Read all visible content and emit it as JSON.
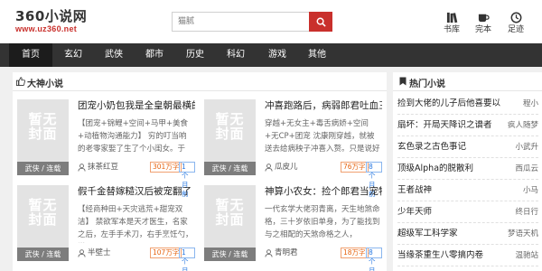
{
  "header": {
    "logo_title": "360小说网",
    "logo_url": "www.uz360.net",
    "search_placeholder": "猫腻",
    "icons": [
      {
        "label": "书库",
        "icon": "bookshelf-icon"
      },
      {
        "label": "完本",
        "icon": "cup-icon"
      },
      {
        "label": "足迹",
        "icon": "clock-icon"
      }
    ]
  },
  "nav": {
    "items": [
      "首页",
      "玄幻",
      "武侠",
      "都市",
      "历史",
      "科幻",
      "游戏",
      "其他"
    ],
    "active": "首页"
  },
  "main": {
    "section_title": "大神小说",
    "books": [
      {
        "cover_text": [
          "暂无",
          "封面"
        ],
        "tag": "武侠 / 连载",
        "title": "团宠小奶包我是全皇朝最横的",
        "desc": "【团宠+锦鲤+空间+马甲+美食+动植物沟通能力】 穷的叮当响的老零家娶了生了个小闺女。于",
        "author": "抹茶红豆",
        "words": "301万字",
        "time": "1个月前"
      },
      {
        "cover_text": [
          "暂无",
          "封面"
        ],
        "tag": "武侠 / 连载",
        "title": "冲喜跑路后，病弱郎君吐血三",
        "desc": "穿越+无女主+毒舌病娇+空间+无CP+团宠 沈康刚穿越，就被送去给病秧子冲喜入赘。只是说好",
        "author": "瓜皮儿",
        "words": "76万字",
        "time": "8个月前"
      },
      {
        "cover_text": [
          "暂无",
          "封面"
        ],
        "tag": "武侠 / 连载",
        "title": "假千金替嫁糙汉后被宠翻了",
        "desc": "【经商种田+天灾逃荒+甜宠双洁】 禁欲军本是天才医生，名家之后，左手手术刀，右手烹饪勺，堪",
        "author": "半壁士",
        "words": "107万字",
        "time": "1个月前"
      },
      {
        "cover_text": [
          "暂无",
          "封面"
        ],
        "tag": "武侠 / 连载",
        "title": "神算小农女：捡个郎君当宠物",
        "desc": "一代玄学大佬羽青离，天生地煞命格，三十岁依旧单身，为了能找到与之相配的天煞命格之人，",
        "author": "青明君",
        "words": "18万字",
        "time": "8个月前"
      }
    ]
  },
  "side": {
    "title": "热门小说",
    "items": [
      {
        "name": "捡到大佬的儿子后他喜要以",
        "author": "程小"
      },
      {
        "name": "扇坏：开局天降识之谱者",
        "author": "疯人随梦"
      },
      {
        "name": "玄色录之古色事记",
        "author": "小武升"
      },
      {
        "name": "顶级Alpha的脱散利",
        "author": "西瓜云"
      },
      {
        "name": "王者战神",
        "author": "小马"
      },
      {
        "name": "少年天师",
        "author": "终日行"
      },
      {
        "name": "超级军工科学家",
        "author": "梦语天机"
      },
      {
        "name": "当缘茶重生八零搞内卷",
        "author": "温驰站"
      }
    ]
  },
  "colors": {
    "accent": "#c9302c",
    "nav_bg": "#333333",
    "words_badge": "#e6630f",
    "time_badge": "#2a7ae2"
  }
}
